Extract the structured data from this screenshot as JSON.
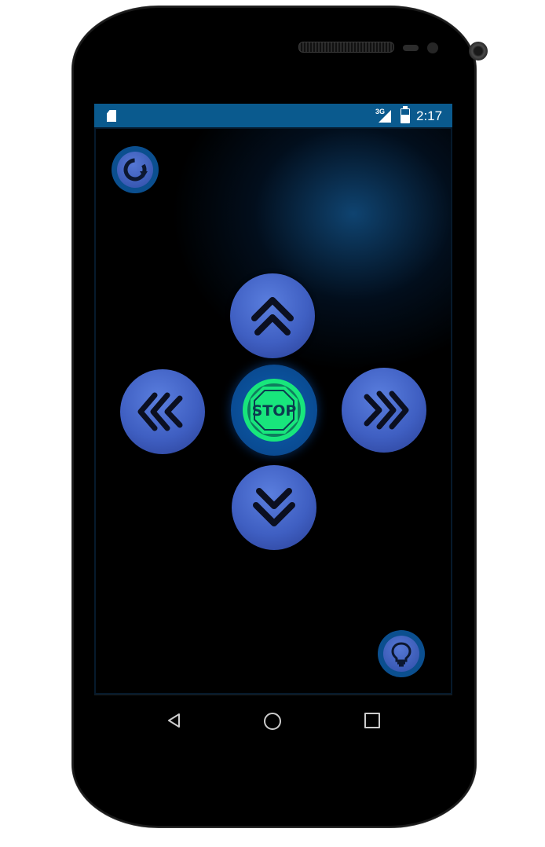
{
  "status_bar": {
    "network": "3G",
    "time": "2:17"
  },
  "controls": {
    "stop_label": "STOP",
    "refresh_icon": "refresh-icon",
    "up_icon": "double-chevron-up-icon",
    "down_icon": "double-chevron-down-icon",
    "left_icon": "triple-chevron-left-icon",
    "right_icon": "triple-chevron-right-icon",
    "light_icon": "lightbulb-icon"
  },
  "navigation": {
    "back_icon": "back-triangle-icon",
    "home_icon": "home-circle-icon",
    "recents_icon": "recents-square-icon"
  },
  "colors": {
    "status_bar": "#0a5a8e",
    "button_blue": "#3f5fc2",
    "stop_green": "#18e67c",
    "background": "#000000"
  }
}
